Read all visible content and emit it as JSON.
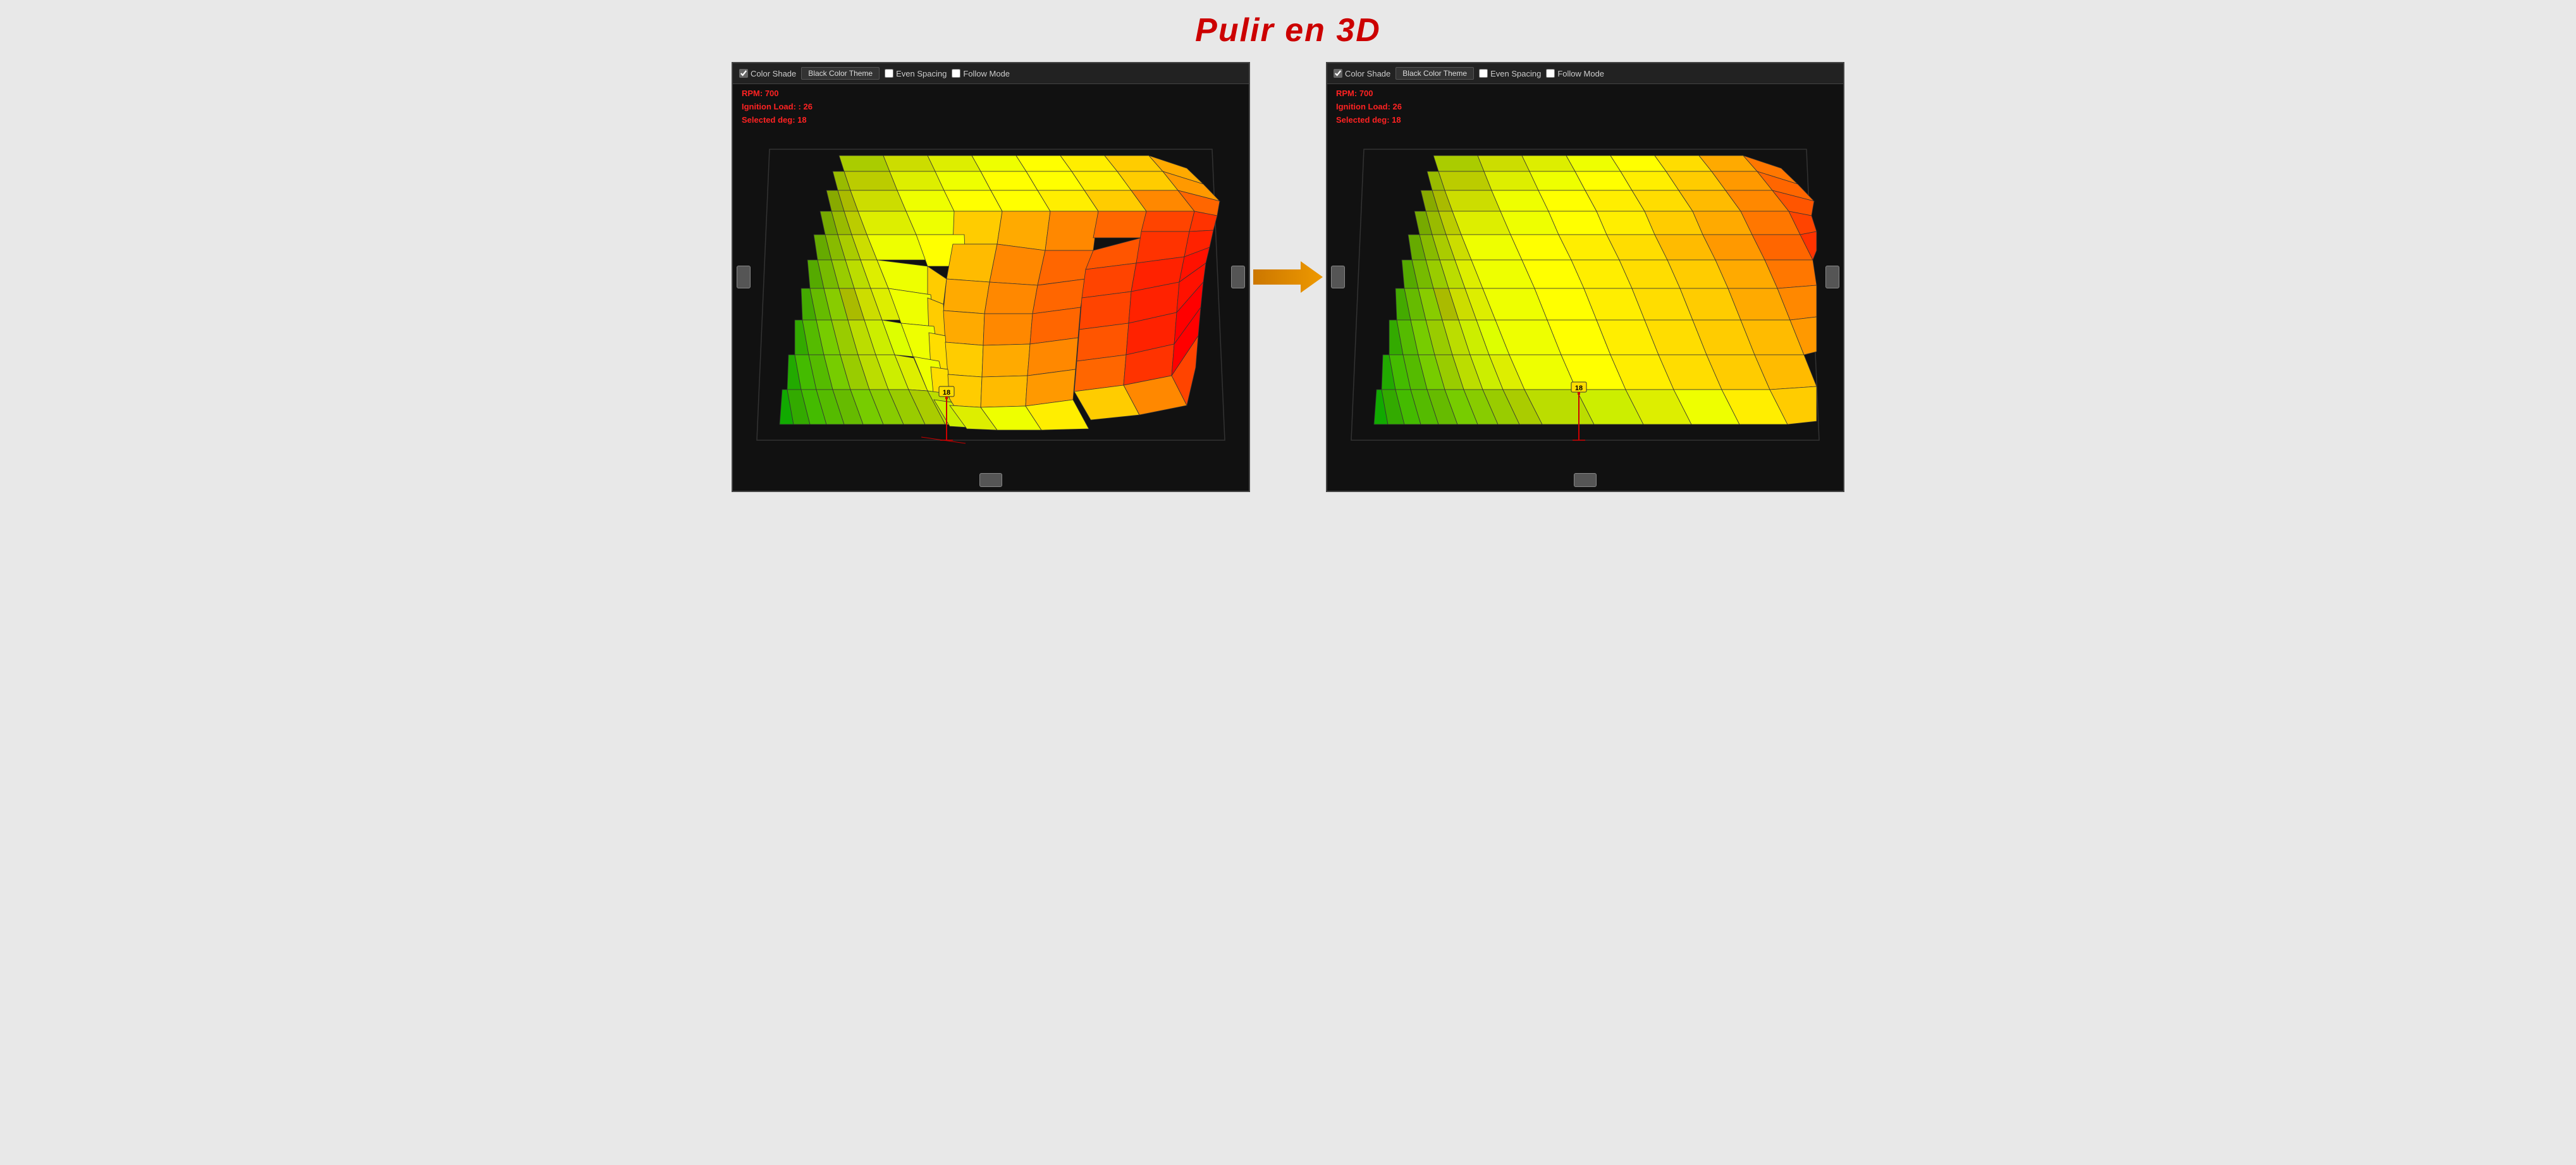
{
  "page": {
    "title": "Pulir en 3D",
    "background": "#e8e8e8"
  },
  "panel_left": {
    "toolbar": {
      "color_shade_label": "Color Shade",
      "color_shade_checked": true,
      "theme_button_label": "Black Color Theme",
      "even_spacing_label": "Even Spacing",
      "even_spacing_checked": false,
      "follow_mode_label": "Follow Mode",
      "follow_mode_checked": false
    },
    "info": {
      "rpm": "RPM: 700",
      "ignition_load": "Ignition Load: : 26",
      "selected_deg": "Selected deg: 18"
    }
  },
  "panel_right": {
    "toolbar": {
      "color_shade_label": "Color Shade",
      "color_shade_checked": true,
      "theme_button_label": "Black Color Theme",
      "even_spacing_label": "Even Spacing",
      "even_spacing_checked": false,
      "follow_mode_label": "Follow Mode",
      "follow_mode_checked": false
    },
    "info": {
      "rpm": "RPM: 700",
      "ignition_load": "Ignition Load: 26",
      "selected_deg": "Selected deg: 18"
    }
  },
  "arrow": {
    "label": "→"
  }
}
